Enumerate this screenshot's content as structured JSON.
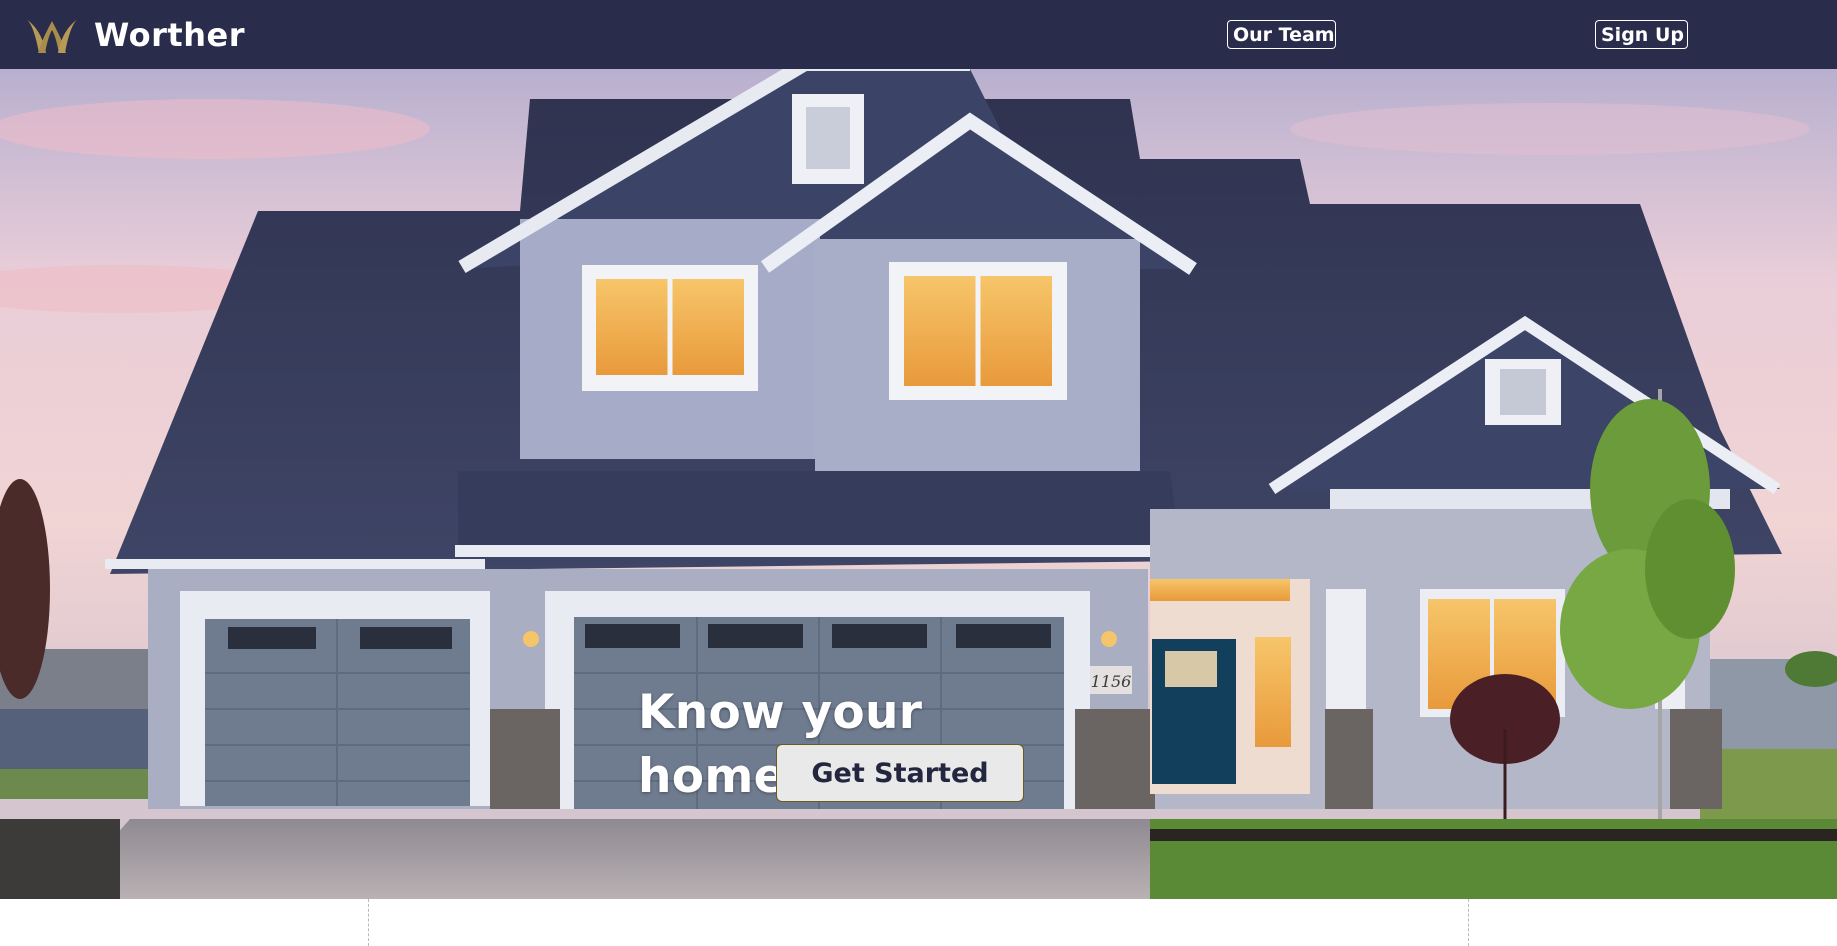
{
  "header": {
    "brand_name": "Worther",
    "logo_icon": "crown-w-logo",
    "nav": {
      "team_label": "Our Team",
      "signup_label": "Sign Up"
    }
  },
  "hero": {
    "background": "suburban-house-at-dusk-photo",
    "title": "Know your home's worth",
    "cta_label": "Get Started",
    "house_number": "1156"
  },
  "colors": {
    "navbar": "#292c4a",
    "logo_gold": "#b79a55",
    "cta_bg": "#e9e9e9",
    "cta_text": "#23263f",
    "cta_border": "#6b5a1f"
  }
}
